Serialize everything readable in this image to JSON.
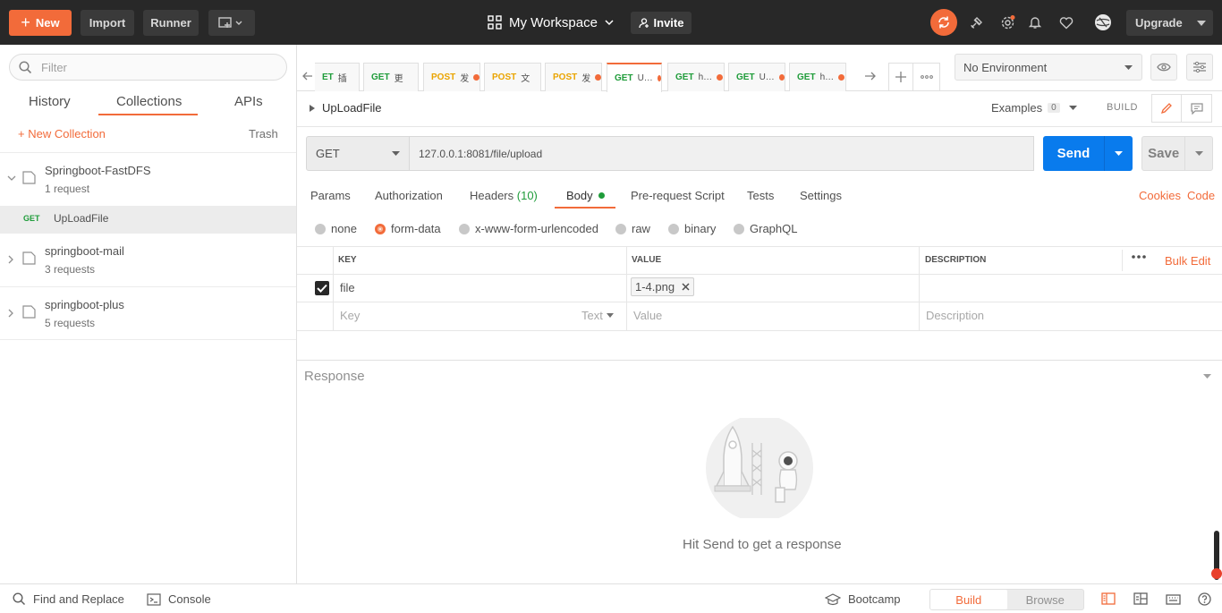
{
  "topbar": {
    "new_label": "New",
    "import_label": "Import",
    "runner_label": "Runner",
    "workspace_label": "My Workspace",
    "invite_label": "Invite",
    "upgrade_label": "Upgrade"
  },
  "sidebar": {
    "filter_placeholder": "Filter",
    "tabs": [
      "History",
      "Collections",
      "APIs"
    ],
    "new_collection": "+ New Collection",
    "trash": "Trash",
    "collections": [
      {
        "name": "Springboot-FastDFS",
        "count": "1 request",
        "expanded": true
      },
      {
        "name": "springboot-mail",
        "count": "3 requests"
      },
      {
        "name": "springboot-plus",
        "count": "5 requests"
      }
    ],
    "request": {
      "method": "GET",
      "name": "UpLoadFile"
    }
  },
  "tabs": [
    {
      "method": "ET",
      "title": "插",
      "type": "get"
    },
    {
      "method": "GET",
      "title": "更",
      "type": "get"
    },
    {
      "method": "POST",
      "title": "发",
      "type": "post",
      "dirty": true
    },
    {
      "method": "POST",
      "title": "文",
      "type": "post"
    },
    {
      "method": "POST",
      "title": "发",
      "type": "post",
      "dirty": true
    },
    {
      "method": "GET",
      "title": "U…",
      "type": "get",
      "dirty": true,
      "active": true
    },
    {
      "method": "GET",
      "title": "h…",
      "type": "get",
      "dirty": true
    },
    {
      "method": "GET",
      "title": "U…",
      "type": "get",
      "dirty": true
    },
    {
      "method": "GET",
      "title": "h…",
      "type": "get",
      "dirty": true
    }
  ],
  "environment": "No Environment",
  "request": {
    "title": "UpLoadFile",
    "examples_label": "Examples",
    "examples_count": "0",
    "build_label": "BUILD",
    "method": "GET",
    "url": "127.0.0.1:8081/file/upload",
    "send_label": "Send",
    "save_label": "Save"
  },
  "request_tabs": {
    "params": "Params",
    "authorization": "Authorization",
    "headers": "Headers",
    "headers_count": "(10)",
    "body": "Body",
    "prerequest": "Pre-request Script",
    "tests": "Tests",
    "settings": "Settings",
    "cookies": "Cookies",
    "code": "Code"
  },
  "body_types": [
    "none",
    "form-data",
    "x-www-form-urlencoded",
    "raw",
    "binary",
    "GraphQL"
  ],
  "table": {
    "headers": {
      "key": "KEY",
      "value": "VALUE",
      "description": "DESCRIPTION",
      "bulk_edit": "Bulk Edit"
    },
    "row": {
      "key": "file",
      "value": "1-4.png"
    },
    "placeholder": {
      "key": "Key",
      "type": "Text",
      "value": "Value",
      "description": "Description"
    }
  },
  "response": {
    "label": "Response",
    "empty_text": "Hit Send to get a response"
  },
  "footer": {
    "find_replace": "Find and Replace",
    "console": "Console",
    "bootcamp": "Bootcamp",
    "build": "Build",
    "browse": "Browse"
  },
  "colors": {
    "accent": "#f26b3a",
    "send": "#097bed",
    "get": "#1f9c3a",
    "post": "#eaa400"
  }
}
